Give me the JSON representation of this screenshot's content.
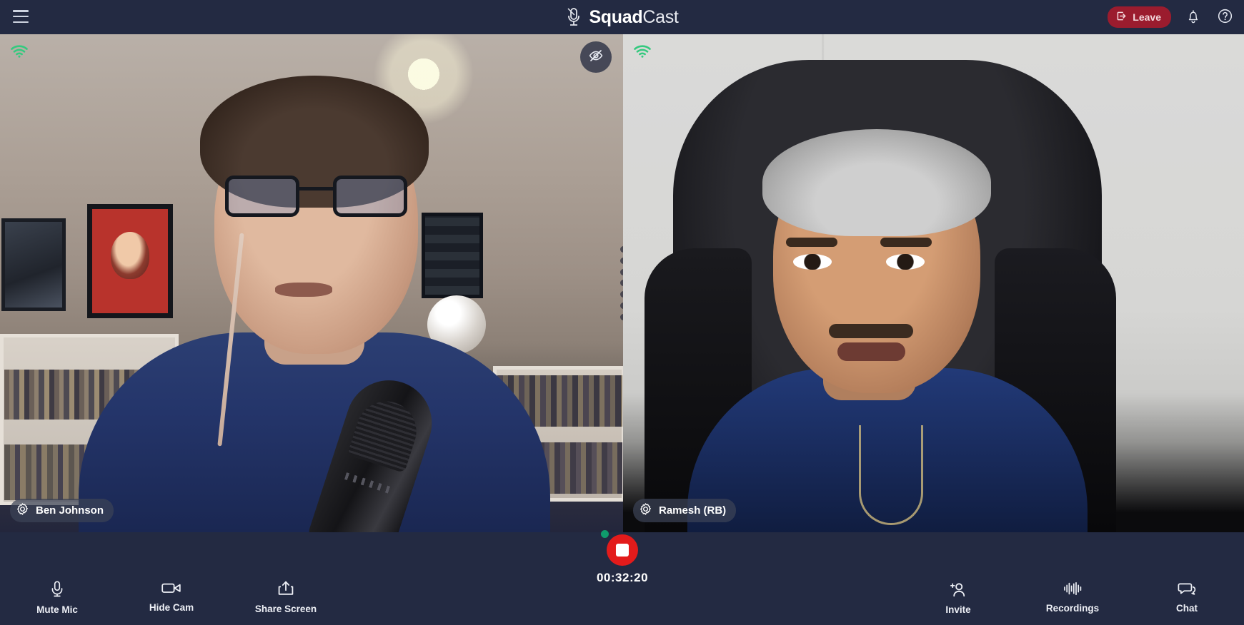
{
  "app": {
    "brand_bold": "Squad",
    "brand_light": "Cast",
    "brand_icon": "microphone-logo-icon"
  },
  "header": {
    "menu_icon": "hamburger-menu-icon",
    "leave_label": "Leave",
    "leave_icon": "exit-arrow-icon",
    "leave_color": "#9b1c2e",
    "notifications_icon": "bell-icon",
    "help_icon": "question-circle-icon"
  },
  "participants": [
    {
      "name": "Ben Johnson",
      "settings_icon": "gear-icon",
      "connection_icon": "wifi-signal-icon",
      "connection_color": "#35c97f",
      "hide_icon": "eye-off-icon",
      "hide_icon_visible": true
    },
    {
      "name": "Ramesh (RB)",
      "settings_icon": "gear-icon",
      "connection_icon": "wifi-signal-icon",
      "connection_color": "#35c97f",
      "hide_icon": "eye-off-icon",
      "hide_icon_visible": false
    }
  ],
  "toolbar": {
    "left": [
      {
        "label": "Mute Mic",
        "icon": "microphone-icon"
      },
      {
        "label": "Hide Cam",
        "icon": "video-camera-icon"
      },
      {
        "label": "Share Screen",
        "icon": "share-screen-icon"
      }
    ],
    "right": [
      {
        "label": "Invite",
        "icon": "add-person-icon"
      },
      {
        "label": "Recordings",
        "icon": "audio-waveform-icon"
      },
      {
        "label": "Chat",
        "icon": "chat-bubbles-icon"
      }
    ]
  },
  "recording": {
    "timer": "00:32:20",
    "state_icon": "stop-square-icon",
    "button_color": "#e31b1b",
    "live_dot_color": "#0f9b6c"
  }
}
